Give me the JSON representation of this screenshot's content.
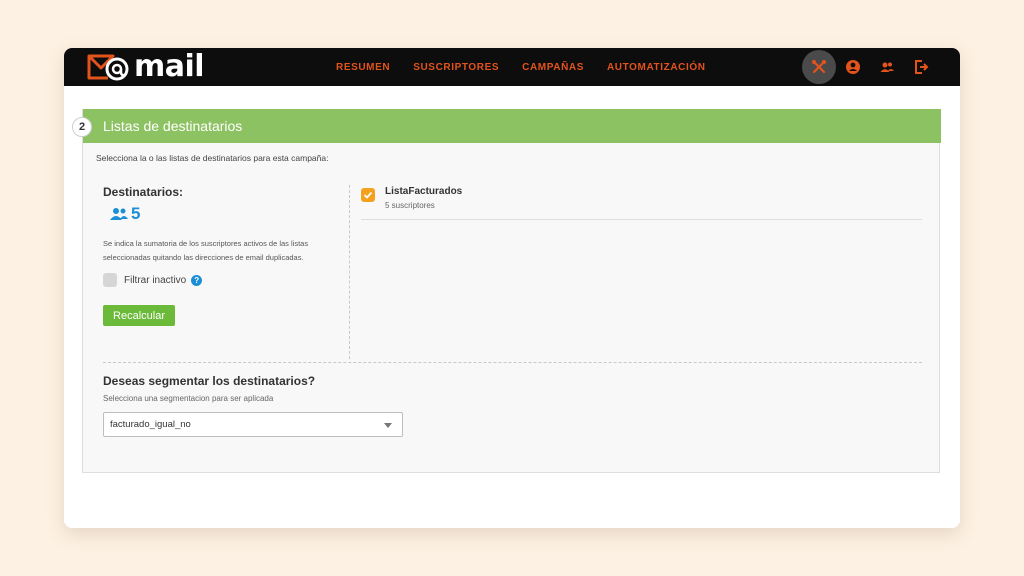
{
  "app": {
    "logo_text": "mail",
    "brand_color": "#e3531c",
    "accent_green": "#8dc263"
  },
  "nav": {
    "items": [
      "RESUMEN",
      "SUSCRIPTORES",
      "CAMPAÑAS",
      "AUTOMATIZACIÓN"
    ]
  },
  "toolbar_icons": [
    "tools-icon",
    "account-icon",
    "users-icon",
    "logout-icon"
  ],
  "section": {
    "step": "2",
    "title": "Listas de destinatarios",
    "instructions": "Selecciona la o las listas de destinatarios para esta campaña:"
  },
  "recipients": {
    "label": "Destinatarios:",
    "count": "5",
    "description": "Se indica la sumatoria de los suscriptores activos de las listas seleccionadas quitando las direcciones de email duplicadas.",
    "filter_label": "Filtrar inactivo",
    "filter_checked": false,
    "recalc_label": "Recalcular"
  },
  "lists": [
    {
      "name": "ListaFacturados",
      "subscribers": "5 suscriptores",
      "checked": true
    }
  ],
  "segmentation": {
    "title": "Deseas segmentar los destinatarios?",
    "subtitle": "Selecciona una segmentacion para ser aplicada",
    "selected": "facturado_igual_no"
  }
}
